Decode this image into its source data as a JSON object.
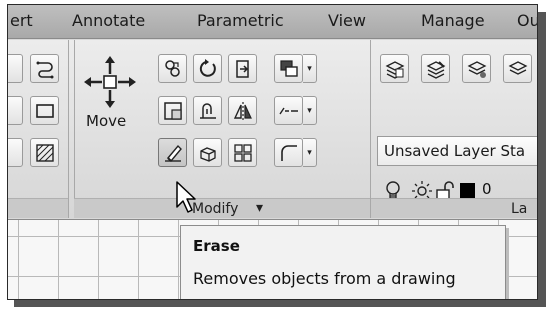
{
  "tabs": [
    {
      "label": "ert"
    },
    {
      "label": "Annotate"
    },
    {
      "label": "Parametric"
    },
    {
      "label": "View"
    },
    {
      "label": "Manage"
    },
    {
      "label": "Ou"
    }
  ],
  "modify_panel": {
    "move_label": "Move",
    "panel_label": "Modify",
    "panel_arrow": "▾"
  },
  "layers_panel": {
    "current_layer": "Unsaved Layer Sta",
    "color_value": "0",
    "panel_label": "La"
  },
  "tooltip": {
    "title": "Erase",
    "description": "Removes objects from a drawing"
  },
  "dropdown_glyph": "▾"
}
